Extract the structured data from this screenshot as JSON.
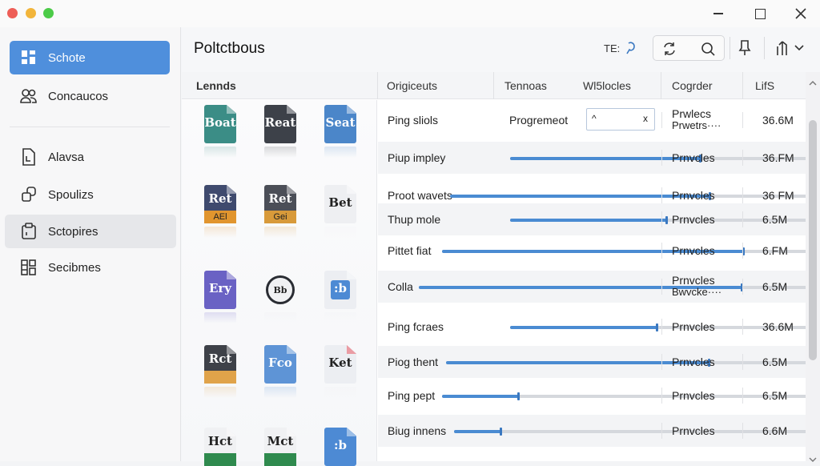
{
  "sidebar": {
    "items": [
      {
        "label": "Schote",
        "icon": "dashboard-icon"
      },
      {
        "label": "Concaucos",
        "icon": "users-icon"
      },
      {
        "label": "Alavsa",
        "icon": "document-icon"
      },
      {
        "label": "Spoulizs",
        "icon": "shapes-icon"
      },
      {
        "label": "Sctopires",
        "icon": "clipboard-icon"
      },
      {
        "label": "Secibmes",
        "icon": "grid-icon"
      }
    ]
  },
  "header": {
    "title": "Poltctbous",
    "toolbar_label": "TE:"
  },
  "table": {
    "columns": [
      "Lennds",
      "Origiceuts",
      "Tennoas",
      "Wl5locles",
      "Cogrder",
      "LifS"
    ],
    "inline_input": {
      "left": "^",
      "right": "x"
    },
    "rows": [
      {
        "name": "Ping sliols",
        "col2": "Progremeot",
        "type": "Prwlecs",
        "type2": "Prwetrs····",
        "size": "36.6M",
        "progress": null
      },
      {
        "name": "Piup impley",
        "col2": "",
        "type": "Prnvcles",
        "type2": "",
        "size": "36.FM",
        "progress": 0.57
      },
      {
        "name": "Proot wavets",
        "col2": "",
        "type": "Prnvcles",
        "type2": "",
        "size": "36 FM",
        "progress": 0.66
      },
      {
        "name": "Thup mole",
        "col2": "",
        "type": "Prnvcles",
        "type2": "",
        "size": "6.5M",
        "progress": 0.47
      },
      {
        "name": "Pittet fiat",
        "col2": "",
        "type": "Prnvcles",
        "type2": "",
        "size": "6.FM",
        "progress": 0.75
      },
      {
        "name": "Colla",
        "col2": "",
        "type": "Prnvcles",
        "type2": "Bwvcke····",
        "size": "6.5M",
        "progress": 0.76
      },
      {
        "name": "Ping fcraes",
        "col2": "",
        "type": "Prnvcles",
        "type2": "",
        "size": "36.6M",
        "progress": 0.44
      },
      {
        "name": "Piog thent",
        "col2": "",
        "type": "Prnvcles",
        "type2": "",
        "size": "6.5M",
        "progress": 0.66
      },
      {
        "name": "Ping pept",
        "col2": "",
        "type": "Prnvcles",
        "type2": "",
        "size": "6.5M",
        "progress": 0.19
      },
      {
        "name": "Biug innens",
        "col2": "",
        "type": "Prnvcles",
        "type2": "",
        "size": "6.6M",
        "progress": 0.12
      }
    ],
    "thumbnails": [
      {
        "text": "Boat",
        "color": "#3b8d86",
        "band": ""
      },
      {
        "text": "Reat",
        "color": "#3d4149",
        "band": ""
      },
      {
        "text": "Seat",
        "color": "#4b86c9",
        "band": ""
      },
      {
        "text": "Ret",
        "color": "#3f4a6e",
        "band": "#e1952e",
        "band_text": "AEl"
      },
      {
        "text": "Ret",
        "color": "#4b4e57",
        "band": "#d89a3a",
        "band_text": "Gei"
      },
      {
        "text": "Bet",
        "color": "#eeeff2",
        "band": "",
        "dark_text": true
      },
      {
        "text": "Ery",
        "color": "#6a62c4",
        "band": ""
      },
      {
        "text": "Bb",
        "color": "#e9eaee",
        "band": "",
        "dark_text": true,
        "round": true
      },
      {
        "text": ":b",
        "color": "#eceef2",
        "band": "",
        "blue_inner": true
      },
      {
        "text": "Rct",
        "color": "#3e4148",
        "band": "#e0a34a"
      },
      {
        "text": "Fco",
        "color": "#5e94d6",
        "band": ""
      },
      {
        "text": "Ket",
        "color": "#eceef2",
        "band": "",
        "dark_text": true,
        "accent": "#d94b5a"
      },
      {
        "text": "Hct",
        "color": "#f0f1f3",
        "band": "#2f8a4e",
        "dark_text": true
      },
      {
        "text": "Mct",
        "color": "#f0f1f3",
        "band": "#2f8a4e",
        "dark_text": true
      },
      {
        "text": ":b",
        "color": "#4d8ad4",
        "band": ""
      }
    ]
  },
  "colors": {
    "accent": "#4f8fdc",
    "progress": "#4a8bd2"
  }
}
